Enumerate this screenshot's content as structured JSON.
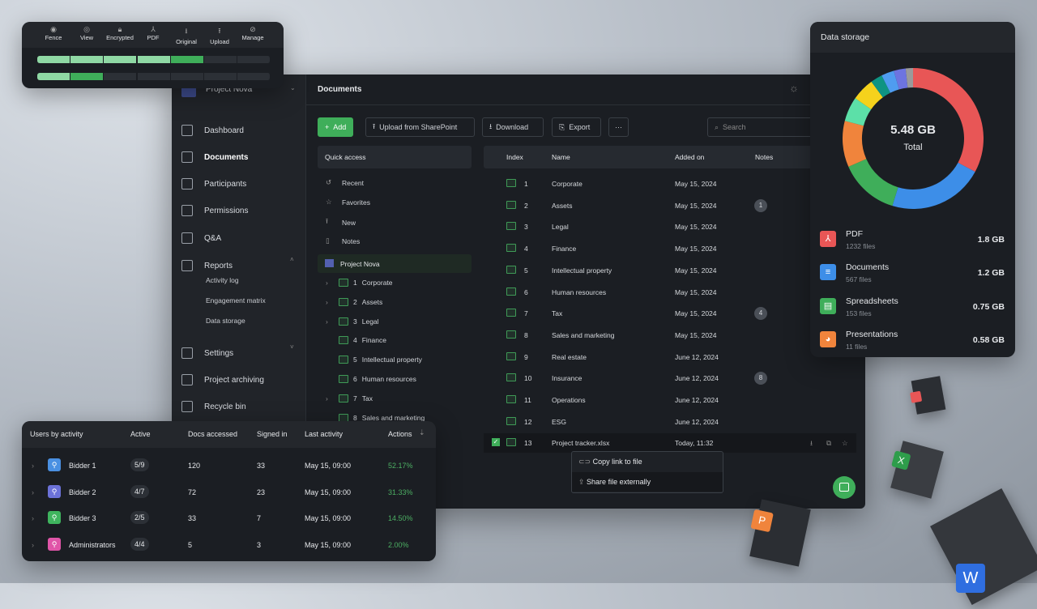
{
  "permissions_card": {
    "columns": [
      "Fence",
      "View",
      "Encrypted",
      "PDF",
      "Original",
      "Upload",
      "Manage"
    ],
    "rows": [
      {
        "light": 4,
        "dark": 1,
        "total": 7
      },
      {
        "light": 1,
        "dark": 1,
        "total": 7
      }
    ]
  },
  "sidebar": {
    "project": "Project Nova",
    "items": [
      {
        "label": "Dashboard"
      },
      {
        "label": "Documents"
      },
      {
        "label": "Participants"
      },
      {
        "label": "Permissions"
      },
      {
        "label": "Q&A"
      },
      {
        "label": "Reports"
      },
      {
        "label": "Settings"
      },
      {
        "label": "Project archiving"
      },
      {
        "label": "Recycle bin"
      }
    ],
    "report_sub": [
      "Activity log",
      "Engagement matrix",
      "Data storage"
    ]
  },
  "header": {
    "title": "Documents"
  },
  "toolbar": {
    "add": "Add",
    "upload": "Upload from SharePoint",
    "download": "Download",
    "export": "Export",
    "more": "···",
    "search_placeholder": "Search"
  },
  "quick_access": {
    "title": "Quick access",
    "items": [
      "Recent",
      "Favorites",
      "New",
      "Notes"
    ],
    "project": "Project Nova",
    "tree": [
      {
        "i": "1",
        "n": "Corporate",
        "exp": true
      },
      {
        "i": "2",
        "n": "Assets",
        "exp": true
      },
      {
        "i": "3",
        "n": "Legal",
        "exp": true
      },
      {
        "i": "4",
        "n": "Finance",
        "exp": false
      },
      {
        "i": "5",
        "n": "Intellectual property",
        "exp": false
      },
      {
        "i": "6",
        "n": "Human resources",
        "exp": false
      },
      {
        "i": "7",
        "n": "Tax",
        "exp": true
      },
      {
        "i": "8",
        "n": "Sales and marketing",
        "exp": false
      }
    ]
  },
  "table": {
    "headers": [
      "Index",
      "Name",
      "Added on",
      "Notes"
    ],
    "rows": [
      {
        "i": "1",
        "n": "Corporate",
        "d": "May 15, 2024",
        "notes": ""
      },
      {
        "i": "2",
        "n": "Assets",
        "d": "May 15, 2024",
        "notes": "1"
      },
      {
        "i": "3",
        "n": "Legal",
        "d": "May 15, 2024",
        "notes": ""
      },
      {
        "i": "4",
        "n": "Finance",
        "d": "May 15, 2024",
        "notes": ""
      },
      {
        "i": "5",
        "n": "Intellectual property",
        "d": "May 15, 2024",
        "notes": ""
      },
      {
        "i": "6",
        "n": "Human resources",
        "d": "May 15, 2024",
        "notes": ""
      },
      {
        "i": "7",
        "n": "Tax",
        "d": "May 15, 2024",
        "notes": "4"
      },
      {
        "i": "8",
        "n": "Sales and marketing",
        "d": "May 15, 2024",
        "notes": ""
      },
      {
        "i": "9",
        "n": "Real estate",
        "d": "June 12, 2024",
        "notes": ""
      },
      {
        "i": "10",
        "n": "Insurance",
        "d": "June 12, 2024",
        "notes": "8"
      },
      {
        "i": "11",
        "n": "Operations",
        "d": "June 12, 2024",
        "notes": ""
      },
      {
        "i": "12",
        "n": "ESG",
        "d": "June 12, 2024",
        "notes": ""
      },
      {
        "i": "13",
        "n": "Project tracker.xlsx",
        "d": "Today, 11:32",
        "notes": "",
        "file": true,
        "checked": true
      }
    ]
  },
  "context_menu": {
    "items": [
      "Copy link to file",
      "Share file externally"
    ]
  },
  "users": {
    "headers": [
      "Users by activity",
      "Active",
      "Docs accessed",
      "Signed in",
      "Last activity",
      "Actions"
    ],
    "rows": [
      {
        "name": "Bidder 1",
        "active": "5/9",
        "docs": "120",
        "signed": "33",
        "last": "May 15, 09:00",
        "actions": "52.17%",
        "color": "#4a90e2"
      },
      {
        "name": "Bidder 2",
        "active": "4/7",
        "docs": "72",
        "signed": "23",
        "last": "May 15, 09:00",
        "actions": "31.33%",
        "color": "#6c72d8"
      },
      {
        "name": "Bidder 3",
        "active": "2/5",
        "docs": "33",
        "signed": "7",
        "last": "May 15, 09:00",
        "actions": "14.50%",
        "color": "#3fb45e"
      },
      {
        "name": "Administrators",
        "active": "4/4",
        "docs": "5",
        "signed": "3",
        "last": "May 15, 09:00",
        "actions": "2.00%",
        "color": "#e055a8"
      }
    ]
  },
  "storage": {
    "title": "Data storage",
    "total": "5.48 GB",
    "total_label": "Total",
    "items": [
      {
        "name": "PDF",
        "files": "1232 files",
        "size": "1.8 GB",
        "color": "#e85656"
      },
      {
        "name": "Documents",
        "files": "567 files",
        "size": "1.2 GB",
        "color": "#3d8ee8"
      },
      {
        "name": "Spreadsheets",
        "files": "153 files",
        "size": "0.75 GB",
        "color": "#3fae5a"
      },
      {
        "name": "Presentations",
        "files": "11 files",
        "size": "0.58 GB",
        "color": "#f0843c"
      }
    ],
    "other_segment_colors": [
      "#5ce0a8",
      "#f5d21c",
      "#0e9483",
      "#4f9cf0",
      "#6d74e0",
      "#9a9a9a"
    ]
  },
  "accent": "#3fae5a"
}
